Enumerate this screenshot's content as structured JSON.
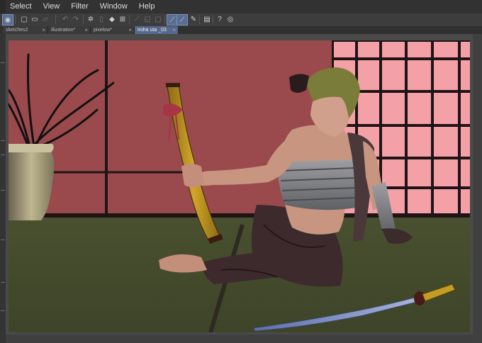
{
  "menu": {
    "items": [
      "Select",
      "View",
      "Filter",
      "Window",
      "Help"
    ]
  },
  "toolbar": {
    "icons": [
      "app-icon",
      "new-icon",
      "open-icon",
      "save-icon",
      "undo-icon",
      "redo-icon",
      "spinner-icon",
      "clear-icon",
      "fill-icon",
      "transform-icon",
      "deselect-icon",
      "select-rect-icon",
      "lasso-icon",
      "pen-active-icon",
      "correction-icon",
      "stroke-icon",
      "layer-icon",
      "help-icon",
      "settings-icon"
    ]
  },
  "tabs": [
    {
      "label": "sketches2",
      "close": "×",
      "active": false
    },
    {
      "label": "illustration*",
      "close": "×",
      "active": false
    },
    {
      "label": "pixelow*",
      "close": "×",
      "active": false
    },
    {
      "label": "iroha uta _03",
      "close": "×",
      "active": true
    }
  ],
  "colors": {
    "wall": "#9a4a4c",
    "floor": "#49502f",
    "shoji_pane": "#f3a1a6",
    "frame": "#1e1416",
    "accent_tab": "#56698d"
  }
}
